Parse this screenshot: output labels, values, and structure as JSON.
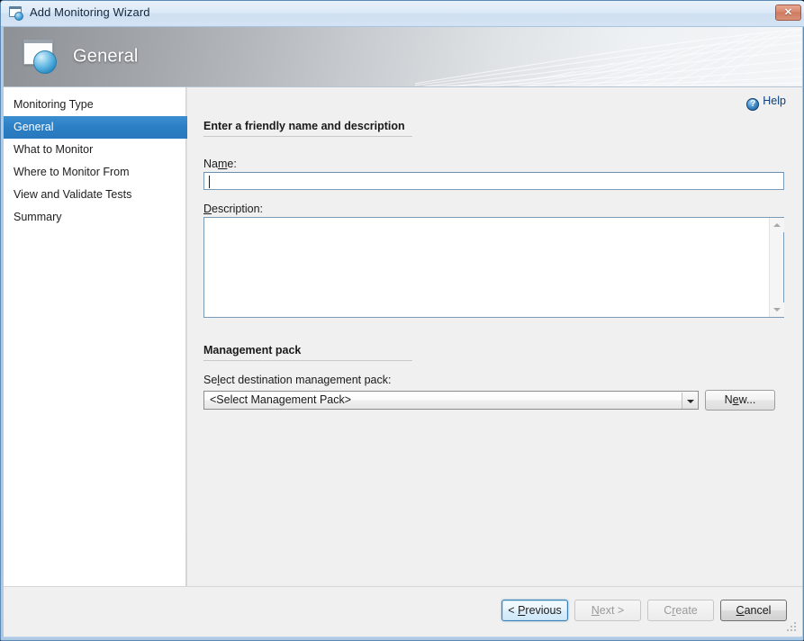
{
  "window": {
    "title": "Add Monitoring Wizard",
    "title_icon": "wizard-window-icon",
    "close_label": "✕"
  },
  "banner": {
    "heading": "General",
    "icon": "wizard-page-sphere-icon"
  },
  "sidebar": {
    "items": [
      {
        "label": "Monitoring Type",
        "selected": false
      },
      {
        "label": "General",
        "selected": true
      },
      {
        "label": "What to Monitor",
        "selected": false
      },
      {
        "label": "Where to Monitor From",
        "selected": false
      },
      {
        "label": "View and Validate Tests",
        "selected": false
      },
      {
        "label": "Summary",
        "selected": false
      }
    ]
  },
  "content": {
    "help": {
      "label": "Help",
      "icon": "help-question-icon"
    },
    "section_name": {
      "heading": "Enter a friendly name and description",
      "name_label_pre": "Na",
      "name_label_accel": "m",
      "name_label_post": "e:",
      "name_value": "",
      "name_placeholder": "",
      "description_label_accel": "D",
      "description_label_post": "escription:",
      "description_value": "",
      "description_placeholder": ""
    },
    "section_mp": {
      "heading": "Management pack",
      "select_label_pre": "Se",
      "select_label_accel": "l",
      "select_label_post": "ect destination management pack:",
      "combo_value": "<Select Management Pack>",
      "new_button_pre": "N",
      "new_button_accel": "e",
      "new_button_post": "w..."
    }
  },
  "footer": {
    "buttons": [
      {
        "name": "previous",
        "pre": "< ",
        "accel": "P",
        "post": "revious",
        "state": "focused"
      },
      {
        "name": "next",
        "pre": "",
        "accel": "N",
        "post": "ext >",
        "state": "disabled"
      },
      {
        "name": "create",
        "pre": "C",
        "accel": "r",
        "post": "eate",
        "state": "disabled"
      },
      {
        "name": "cancel",
        "pre": "",
        "accel": "C",
        "post": "ancel",
        "state": "enabled"
      }
    ]
  },
  "colors": {
    "accent_blue": "#2c7fc4",
    "window_chrome": "#cfe0f2",
    "content_bg": "#f0f0f0",
    "close_red": "#d98a70",
    "link_blue": "#0a3f7d"
  }
}
